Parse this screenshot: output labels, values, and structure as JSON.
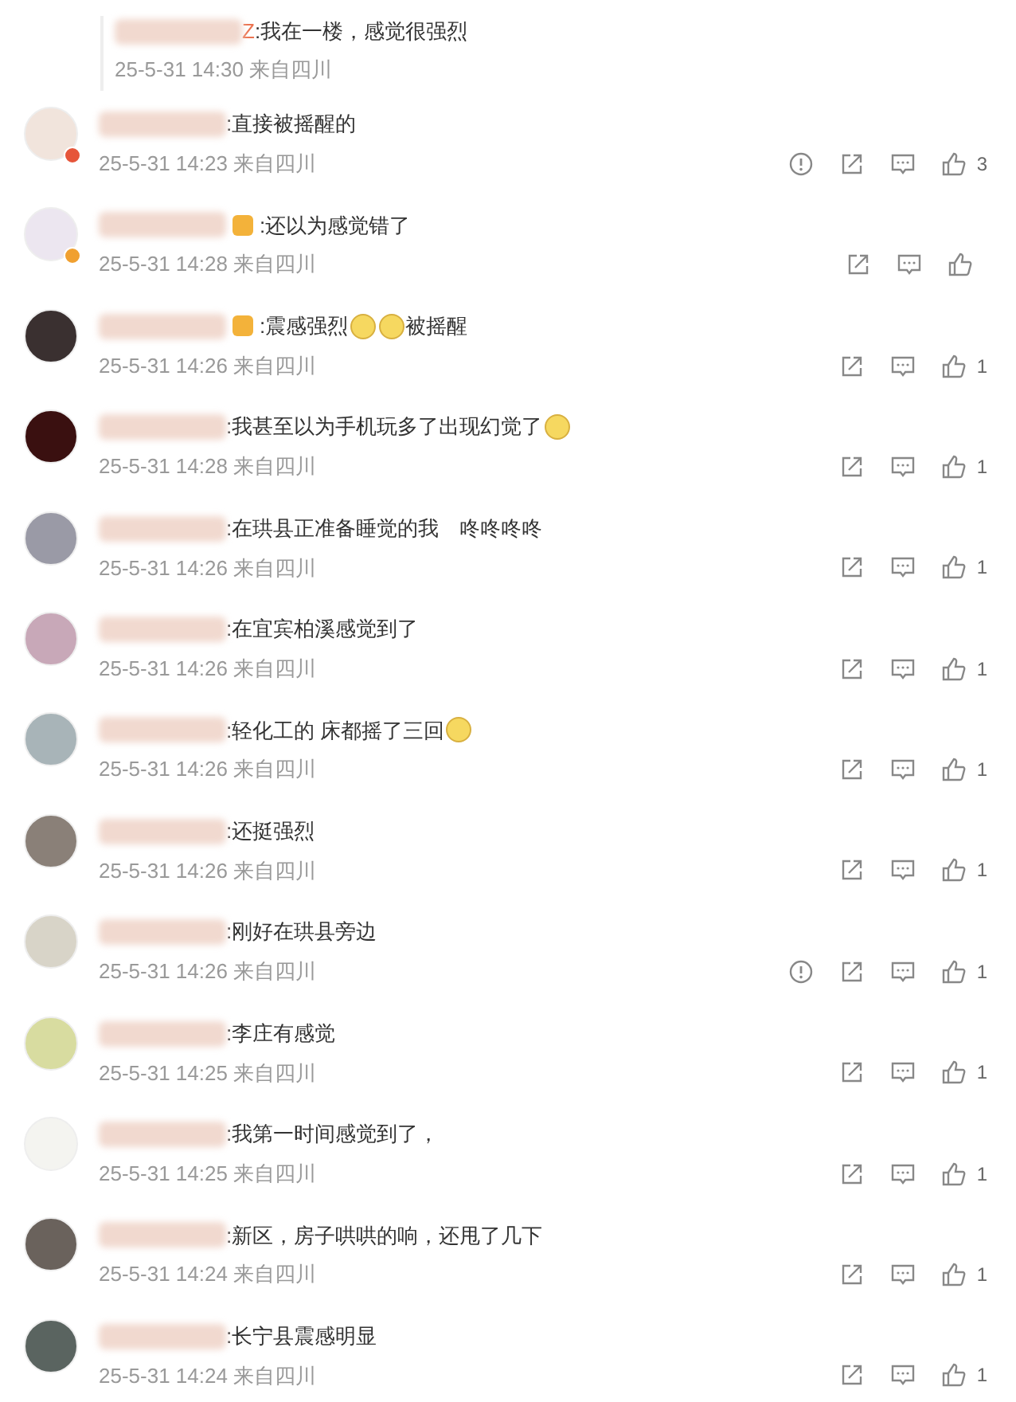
{
  "reply": {
    "name_tail": "Z",
    "segments": [
      {
        "kind": "text",
        "text": ":我在一楼，感觉很强烈"
      }
    ],
    "date": "25-5-31 14:30 来自四川"
  },
  "comments": [
    {
      "avatar_badge": {
        "color": "#e6553a"
      },
      "name_badge": false,
      "segments": [
        {
          "kind": "text",
          "text": ":直接被摇醒的"
        }
      ],
      "date": "25-5-31 14:23 来自四川",
      "report": true,
      "likes": "3"
    },
    {
      "avatar_badge": {
        "color": "#f0a030"
      },
      "name_badge": true,
      "segments": [
        {
          "kind": "text",
          "text": ":还以为感觉错了"
        }
      ],
      "date": "25-5-31 14:28 来自四川",
      "report": false
    },
    {
      "name_badge": true,
      "segments": [
        {
          "kind": "text",
          "text": ":震感强烈"
        },
        {
          "kind": "emoji"
        },
        {
          "kind": "emoji"
        },
        {
          "kind": "text",
          "text": "被摇醒"
        }
      ],
      "date": "25-5-31 14:26 来自四川",
      "report": false,
      "likes": "1"
    },
    {
      "name_badge": false,
      "segments": [
        {
          "kind": "text",
          "text": ":我甚至以为手机玩多了出现幻觉了"
        },
        {
          "kind": "emoji"
        }
      ],
      "date": "25-5-31 14:28 来自四川",
      "report": false,
      "likes": "1"
    },
    {
      "name_badge": false,
      "segments": [
        {
          "kind": "text",
          "text": ":在珙县正准备睡觉的我　咚咚咚咚"
        }
      ],
      "date": "25-5-31 14:26 来自四川",
      "report": false,
      "likes": "1"
    },
    {
      "name_badge": false,
      "segments": [
        {
          "kind": "text",
          "text": ":在宜宾柏溪感觉到了"
        }
      ],
      "date": "25-5-31 14:26 来自四川",
      "report": false,
      "likes": "1"
    },
    {
      "name_badge": false,
      "segments": [
        {
          "kind": "text",
          "text": ":轻化工的 床都摇了三回"
        },
        {
          "kind": "emoji"
        }
      ],
      "date": "25-5-31 14:26 来自四川",
      "report": false,
      "likes": "1"
    },
    {
      "name_badge": false,
      "segments": [
        {
          "kind": "text",
          "text": ":还挺强烈"
        }
      ],
      "date": "25-5-31 14:26 来自四川",
      "report": false,
      "likes": "1"
    },
    {
      "name_badge": false,
      "segments": [
        {
          "kind": "text",
          "text": ":刚好在珙县旁边"
        }
      ],
      "date": "25-5-31 14:26 来自四川",
      "report": true,
      "likes": "1"
    },
    {
      "name_badge": false,
      "segments": [
        {
          "kind": "text",
          "text": ":李庄有感觉"
        }
      ],
      "date": "25-5-31 14:25 来自四川",
      "report": false,
      "likes": "1"
    },
    {
      "name_badge": false,
      "segments": [
        {
          "kind": "text",
          "text": ":我第一时间感觉到了，"
        }
      ],
      "date": "25-5-31 14:25 来自四川",
      "report": false,
      "likes": "1"
    },
    {
      "name_badge": false,
      "segments": [
        {
          "kind": "text",
          "text": ":新区，房子哄哄的响，还甩了几下"
        }
      ],
      "date": "25-5-31 14:24 来自四川",
      "report": false,
      "likes": "1"
    },
    {
      "name_badge": false,
      "segments": [
        {
          "kind": "text",
          "text": ":长宁县震感明显"
        }
      ],
      "date": "25-5-31 14:24 来自四川",
      "report": false,
      "likes": "1"
    }
  ]
}
